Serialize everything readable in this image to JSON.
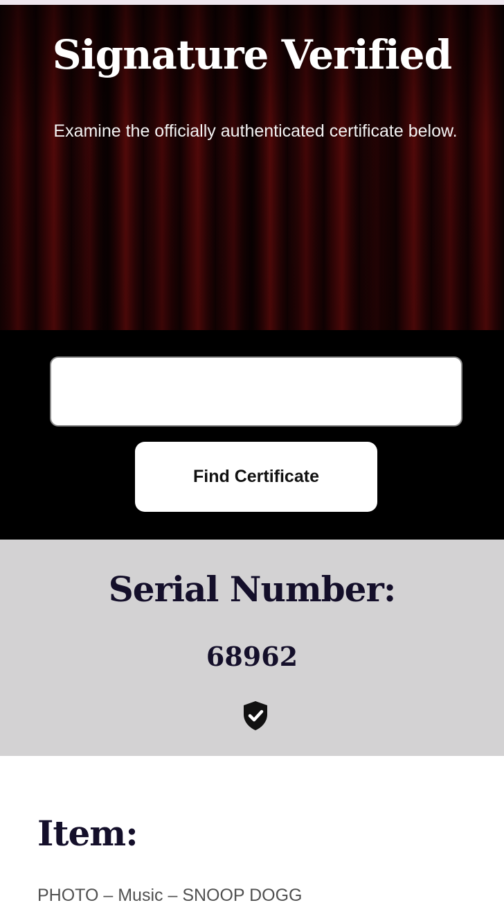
{
  "hero": {
    "title": "Signature Verified",
    "subtitle": "Examine the officially authenticated certificate below."
  },
  "search": {
    "input_value": "",
    "placeholder": "",
    "button_label": "Find Certificate"
  },
  "serial": {
    "label": "Serial Number:",
    "value": "68962",
    "icon": "shield-check-icon"
  },
  "item": {
    "label": "Item:",
    "value": "PHOTO – Music – SNOOP DOGG"
  },
  "colors": {
    "hero_curtain": "#3a0506",
    "search_band": "#000000",
    "serial_band": "#d3d2d3",
    "heading_text": "#140f2a"
  }
}
